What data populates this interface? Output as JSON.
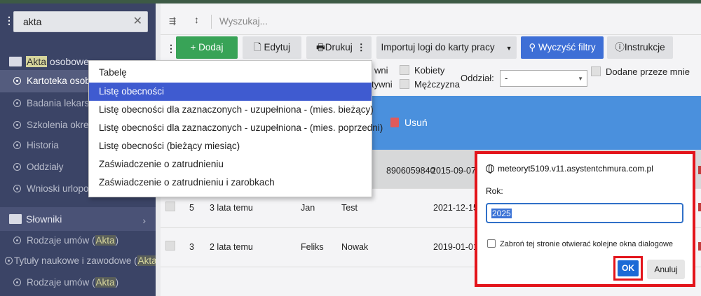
{
  "sidebar": {
    "search_value": "akta",
    "section_akta": {
      "pre": "",
      "highlight": "Akta",
      "post": " osobowe"
    },
    "items": [
      {
        "label": "Kartoteka osob"
      },
      {
        "label": "Badania lekarsk"
      },
      {
        "label": "Szkolenia okres"
      },
      {
        "label": "Historia"
      },
      {
        "label": "Oddziały"
      },
      {
        "label": "Wnioski urlopo"
      }
    ],
    "section_slowniki": "Słowniki",
    "dict_items": [
      {
        "pre": "Rodzaje umów (",
        "highlight": "Akta",
        "post": ")"
      },
      {
        "pre": "Tytuły naukowe i zawodowe (",
        "highlight": "Akta",
        "post": ")"
      },
      {
        "pre": "Rodzaje umów (",
        "highlight": "Akta",
        "post": ")"
      }
    ]
  },
  "search": {
    "placeholder": "Wyszukaj..."
  },
  "toolbar": {
    "add": "Dodaj",
    "edit": "Edytuj",
    "print": "Drukuj",
    "import": "Importuj logi do karty pracy",
    "clear_filters": "Wyczyść filtry",
    "instructions": "Instrukcje"
  },
  "filters": {
    "partial_1": "wni",
    "partial_2": "tywni",
    "women": "Kobiety",
    "men": "Mężczyzna",
    "department_label": "Oddział:",
    "department_value": "-",
    "added_by_me": "Dodane przeze mnie"
  },
  "table": {
    "delete_label": "Usuń",
    "rows": [
      {
        "partial_id": "8906059840",
        "date": "2015-09-07"
      },
      {
        "id": "5",
        "created": "3 lata temu",
        "first": "Jan",
        "last": "Test",
        "date": "2021-12-15"
      },
      {
        "id": "3",
        "created": "2 lata temu",
        "first": "Feliks",
        "last": "Nowak",
        "date": "2019-01-01"
      }
    ]
  },
  "print_menu": {
    "items": [
      "Tabelę",
      "Listę obecności",
      "Listę obecności dla zaznaczonych - uzupełniona - (mies. bieżący)",
      "Listę obecności dla zaznaczonych - uzupełniona - (mies. poprzedni)",
      "Listę obecności (bieżący miesiąc)",
      "Zaświadczenie o zatrudnieniu",
      "Zaświadczenie o zatrudnieniu i zarobkach"
    ],
    "selected_index": 1
  },
  "dialog": {
    "origin": "meteoryt5109.v11.asystentchmura.com.pl",
    "label": "Rok:",
    "value": "2025",
    "checkbox_label": "Zabroń tej stronie otwierać kolejne okna dialogowe",
    "ok": "OK",
    "cancel": "Anuluj"
  },
  "colors": {
    "accent_red": "#e3141b",
    "add_green": "#38a357",
    "header_blue": "#4a90dd",
    "menu_selected": "#3f5bd0"
  }
}
